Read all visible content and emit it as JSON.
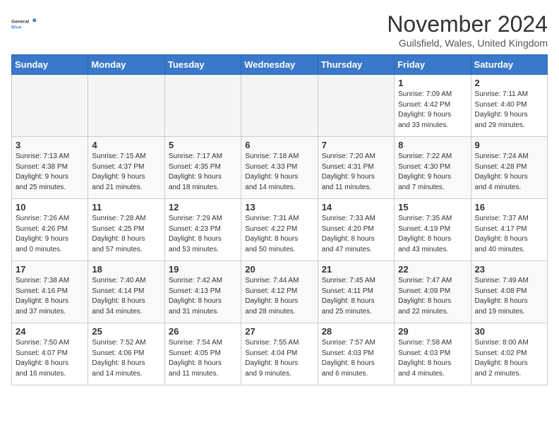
{
  "logo": {
    "line1": "General",
    "line2": "Blue"
  },
  "title": "November 2024",
  "location": "Guilsfield, Wales, United Kingdom",
  "weekdays": [
    "Sunday",
    "Monday",
    "Tuesday",
    "Wednesday",
    "Thursday",
    "Friday",
    "Saturday"
  ],
  "weeks": [
    [
      {
        "day": "",
        "info": ""
      },
      {
        "day": "",
        "info": ""
      },
      {
        "day": "",
        "info": ""
      },
      {
        "day": "",
        "info": ""
      },
      {
        "day": "",
        "info": ""
      },
      {
        "day": "1",
        "info": "Sunrise: 7:09 AM\nSunset: 4:42 PM\nDaylight: 9 hours\nand 33 minutes."
      },
      {
        "day": "2",
        "info": "Sunrise: 7:11 AM\nSunset: 4:40 PM\nDaylight: 9 hours\nand 29 minutes."
      }
    ],
    [
      {
        "day": "3",
        "info": "Sunrise: 7:13 AM\nSunset: 4:38 PM\nDaylight: 9 hours\nand 25 minutes."
      },
      {
        "day": "4",
        "info": "Sunrise: 7:15 AM\nSunset: 4:37 PM\nDaylight: 9 hours\nand 21 minutes."
      },
      {
        "day": "5",
        "info": "Sunrise: 7:17 AM\nSunset: 4:35 PM\nDaylight: 9 hours\nand 18 minutes."
      },
      {
        "day": "6",
        "info": "Sunrise: 7:18 AM\nSunset: 4:33 PM\nDaylight: 9 hours\nand 14 minutes."
      },
      {
        "day": "7",
        "info": "Sunrise: 7:20 AM\nSunset: 4:31 PM\nDaylight: 9 hours\nand 11 minutes."
      },
      {
        "day": "8",
        "info": "Sunrise: 7:22 AM\nSunset: 4:30 PM\nDaylight: 9 hours\nand 7 minutes."
      },
      {
        "day": "9",
        "info": "Sunrise: 7:24 AM\nSunset: 4:28 PM\nDaylight: 9 hours\nand 4 minutes."
      }
    ],
    [
      {
        "day": "10",
        "info": "Sunrise: 7:26 AM\nSunset: 4:26 PM\nDaylight: 9 hours\nand 0 minutes."
      },
      {
        "day": "11",
        "info": "Sunrise: 7:28 AM\nSunset: 4:25 PM\nDaylight: 8 hours\nand 57 minutes."
      },
      {
        "day": "12",
        "info": "Sunrise: 7:29 AM\nSunset: 4:23 PM\nDaylight: 8 hours\nand 53 minutes."
      },
      {
        "day": "13",
        "info": "Sunrise: 7:31 AM\nSunset: 4:22 PM\nDaylight: 8 hours\nand 50 minutes."
      },
      {
        "day": "14",
        "info": "Sunrise: 7:33 AM\nSunset: 4:20 PM\nDaylight: 8 hours\nand 47 minutes."
      },
      {
        "day": "15",
        "info": "Sunrise: 7:35 AM\nSunset: 4:19 PM\nDaylight: 8 hours\nand 43 minutes."
      },
      {
        "day": "16",
        "info": "Sunrise: 7:37 AM\nSunset: 4:17 PM\nDaylight: 8 hours\nand 40 minutes."
      }
    ],
    [
      {
        "day": "17",
        "info": "Sunrise: 7:38 AM\nSunset: 4:16 PM\nDaylight: 8 hours\nand 37 minutes."
      },
      {
        "day": "18",
        "info": "Sunrise: 7:40 AM\nSunset: 4:14 PM\nDaylight: 8 hours\nand 34 minutes."
      },
      {
        "day": "19",
        "info": "Sunrise: 7:42 AM\nSunset: 4:13 PM\nDaylight: 8 hours\nand 31 minutes."
      },
      {
        "day": "20",
        "info": "Sunrise: 7:44 AM\nSunset: 4:12 PM\nDaylight: 8 hours\nand 28 minutes."
      },
      {
        "day": "21",
        "info": "Sunrise: 7:45 AM\nSunset: 4:11 PM\nDaylight: 8 hours\nand 25 minutes."
      },
      {
        "day": "22",
        "info": "Sunrise: 7:47 AM\nSunset: 4:09 PM\nDaylight: 8 hours\nand 22 minutes."
      },
      {
        "day": "23",
        "info": "Sunrise: 7:49 AM\nSunset: 4:08 PM\nDaylight: 8 hours\nand 19 minutes."
      }
    ],
    [
      {
        "day": "24",
        "info": "Sunrise: 7:50 AM\nSunset: 4:07 PM\nDaylight: 8 hours\nand 16 minutes."
      },
      {
        "day": "25",
        "info": "Sunrise: 7:52 AM\nSunset: 4:06 PM\nDaylight: 8 hours\nand 14 minutes."
      },
      {
        "day": "26",
        "info": "Sunrise: 7:54 AM\nSunset: 4:05 PM\nDaylight: 8 hours\nand 11 minutes."
      },
      {
        "day": "27",
        "info": "Sunrise: 7:55 AM\nSunset: 4:04 PM\nDaylight: 8 hours\nand 9 minutes."
      },
      {
        "day": "28",
        "info": "Sunrise: 7:57 AM\nSunset: 4:03 PM\nDaylight: 8 hours\nand 6 minutes."
      },
      {
        "day": "29",
        "info": "Sunrise: 7:58 AM\nSunset: 4:03 PM\nDaylight: 8 hours\nand 4 minutes."
      },
      {
        "day": "30",
        "info": "Sunrise: 8:00 AM\nSunset: 4:02 PM\nDaylight: 8 hours\nand 2 minutes."
      }
    ]
  ]
}
